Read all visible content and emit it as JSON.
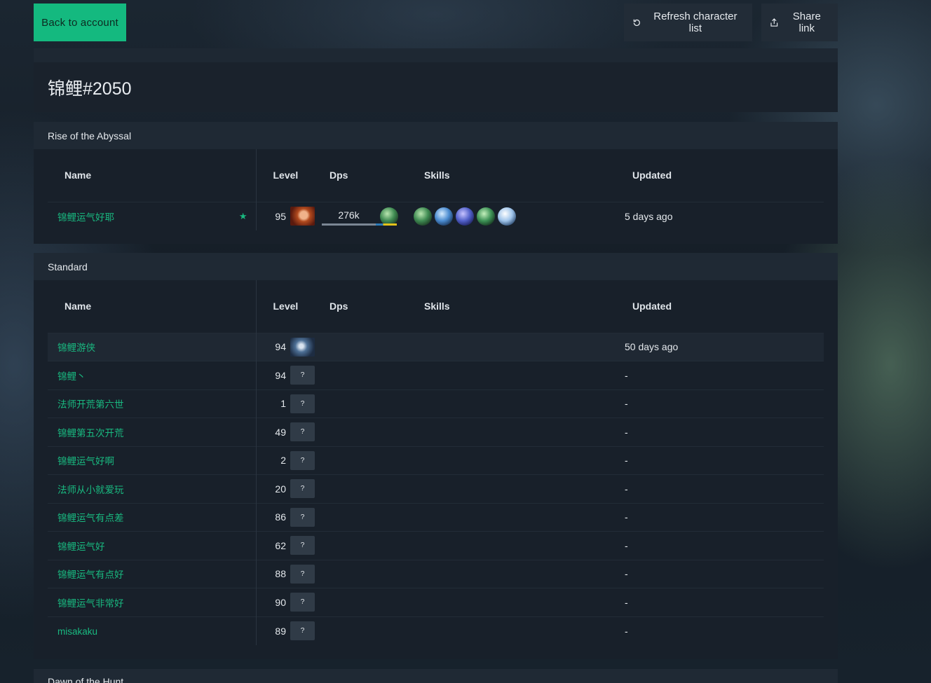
{
  "toolbar": {
    "back_label": "Back to account",
    "refresh_label": "Refresh character list",
    "share_label": "Share link"
  },
  "account": {
    "title": "锦鲤#2050"
  },
  "columns": {
    "name": "Name",
    "level": "Level",
    "dps": "Dps",
    "skills": "Skills",
    "updated": "Updated"
  },
  "leagues": [
    {
      "name": "Rise of the Abyssal",
      "characters": [
        {
          "name": "锦鲤运气好耶",
          "favorite": true,
          "level": "95",
          "portrait": "known",
          "dps": "276k",
          "dps_fraction": 0.72,
          "skills": [
            "skill-gem-green",
            "skill-gem-blue",
            "skill-gem-violet",
            "skill-gem-green",
            "skill-gem-white"
          ],
          "updated": "5 days ago"
        }
      ]
    },
    {
      "name": "Standard",
      "characters": [
        {
          "name": "锦鲤游侠",
          "level": "94",
          "portrait": "known",
          "updated": "50 days ago",
          "highlight": true
        },
        {
          "name": "锦鲤丶",
          "level": "94",
          "portrait": "?",
          "updated": "-"
        },
        {
          "name": "法师开荒第六世",
          "level": "1",
          "portrait": "?",
          "updated": "-"
        },
        {
          "name": "锦鲤第五次开荒",
          "level": "49",
          "portrait": "?",
          "updated": "-"
        },
        {
          "name": "锦鲤运气好啊",
          "level": "2",
          "portrait": "?",
          "updated": "-"
        },
        {
          "name": "法师从小就爱玩",
          "level": "20",
          "portrait": "?",
          "updated": "-"
        },
        {
          "name": "锦鲤运气有点差",
          "level": "86",
          "portrait": "?",
          "updated": "-"
        },
        {
          "name": "锦鲤运气好",
          "level": "62",
          "portrait": "?",
          "updated": "-"
        },
        {
          "name": "锦鲤运气有点好",
          "level": "88",
          "portrait": "?",
          "updated": "-"
        },
        {
          "name": "锦鲤运气非常好",
          "level": "90",
          "portrait": "?",
          "updated": "-"
        },
        {
          "name": "misakaku",
          "level": "89",
          "portrait": "?",
          "updated": "-"
        }
      ]
    },
    {
      "name": "Dawn of the Hunt",
      "characters": []
    }
  ],
  "colors": {
    "accent": "#14b97f",
    "link": "#19b980",
    "panel": "#18202a",
    "panel_header": "#1f2934"
  }
}
